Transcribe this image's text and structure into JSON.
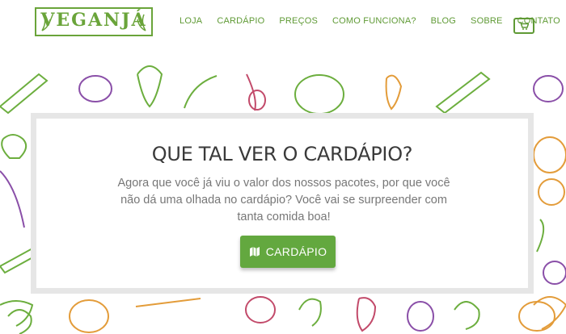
{
  "brand": {
    "logo_text": "VEGANJÁ"
  },
  "nav": {
    "items": [
      "LOJA",
      "CARDÁPIO",
      "PREÇOS",
      "COMO FUNCIONA?",
      "BLOG",
      "SOBRE",
      "CONTATO"
    ]
  },
  "cart": {
    "icon": "cart-icon"
  },
  "modal": {
    "title": "QUE TAL VER O CARDÁPIO?",
    "text": "Agora que você já viu o valor dos nossos pacotes, por que você não dá uma olhada no cardápio? Você vai se surpreender com tanta comida boa!",
    "button_label": "CARDÁPIO",
    "button_icon": "map-icon"
  },
  "colors": {
    "brand_green": "#63a83f",
    "nav_green": "#5f9a35",
    "title": "#3a3a3a",
    "text": "#777777"
  }
}
